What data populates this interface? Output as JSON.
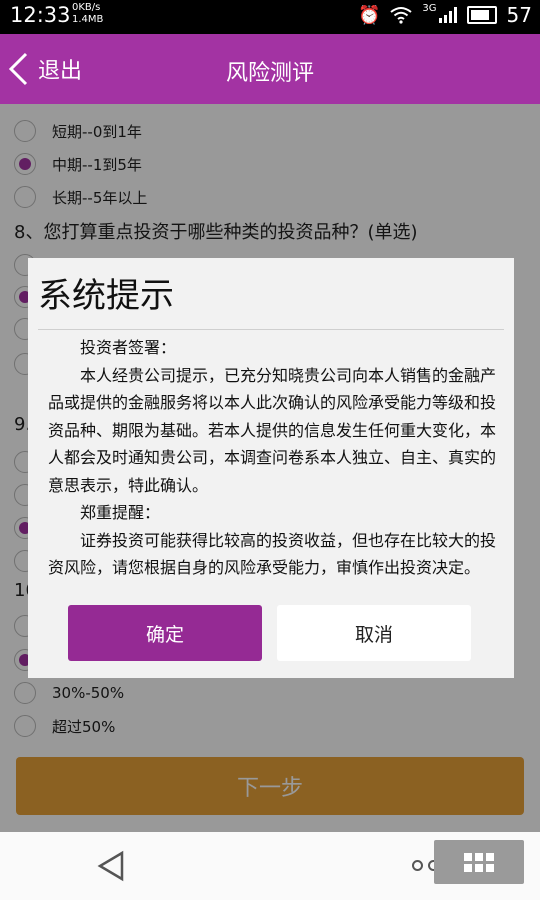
{
  "status": {
    "time": "12:33",
    "net_speed_1": "0KB/s",
    "net_speed_2": "1.4MB",
    "network_type": "3G",
    "battery": "57"
  },
  "header": {
    "back_label": "退出",
    "title": "风险测评"
  },
  "questionnaire": {
    "options_top": [
      {
        "label": "短期--0到1年",
        "selected": false
      },
      {
        "label": "中期--1到5年",
        "selected": true
      },
      {
        "label": "长期--5年以上",
        "selected": false
      }
    ],
    "question_8": "8、您打算重点投资于哪些种类的投资品种？(单选)",
    "fragment_9": "9.",
    "fragment_10": "10",
    "options_bottom": [
      {
        "label": "30%-50%",
        "selected": false
      },
      {
        "label": "超过50%",
        "selected": false
      }
    ],
    "next_label": "下一步"
  },
  "dialog": {
    "title": "系统提示",
    "heading_1": "投资者签署：",
    "paragraph_1": "本人经贵公司提示，已充分知晓贵公司向本人销售的金融产品或提供的金融服务将以本人此次确认的风险承受能力等级和投资品种、期限为基础。若本人提供的信息发生任何重大变化，本人都会及时通知贵公司，本调查问卷系本人独立、自主、真实的意思表示，特此确认。",
    "heading_2": "郑重提醒：",
    "paragraph_2": "证券投资可能获得比较高的投资收益，但也存在比较大的投资风险，请您根据自身的风险承受能力，审慎作出投资决定。",
    "ok_label": "确定",
    "cancel_label": "取消"
  },
  "colors": {
    "brand": "#a333a3",
    "ok_button": "#952a94",
    "next_button": "#e8a23a"
  }
}
